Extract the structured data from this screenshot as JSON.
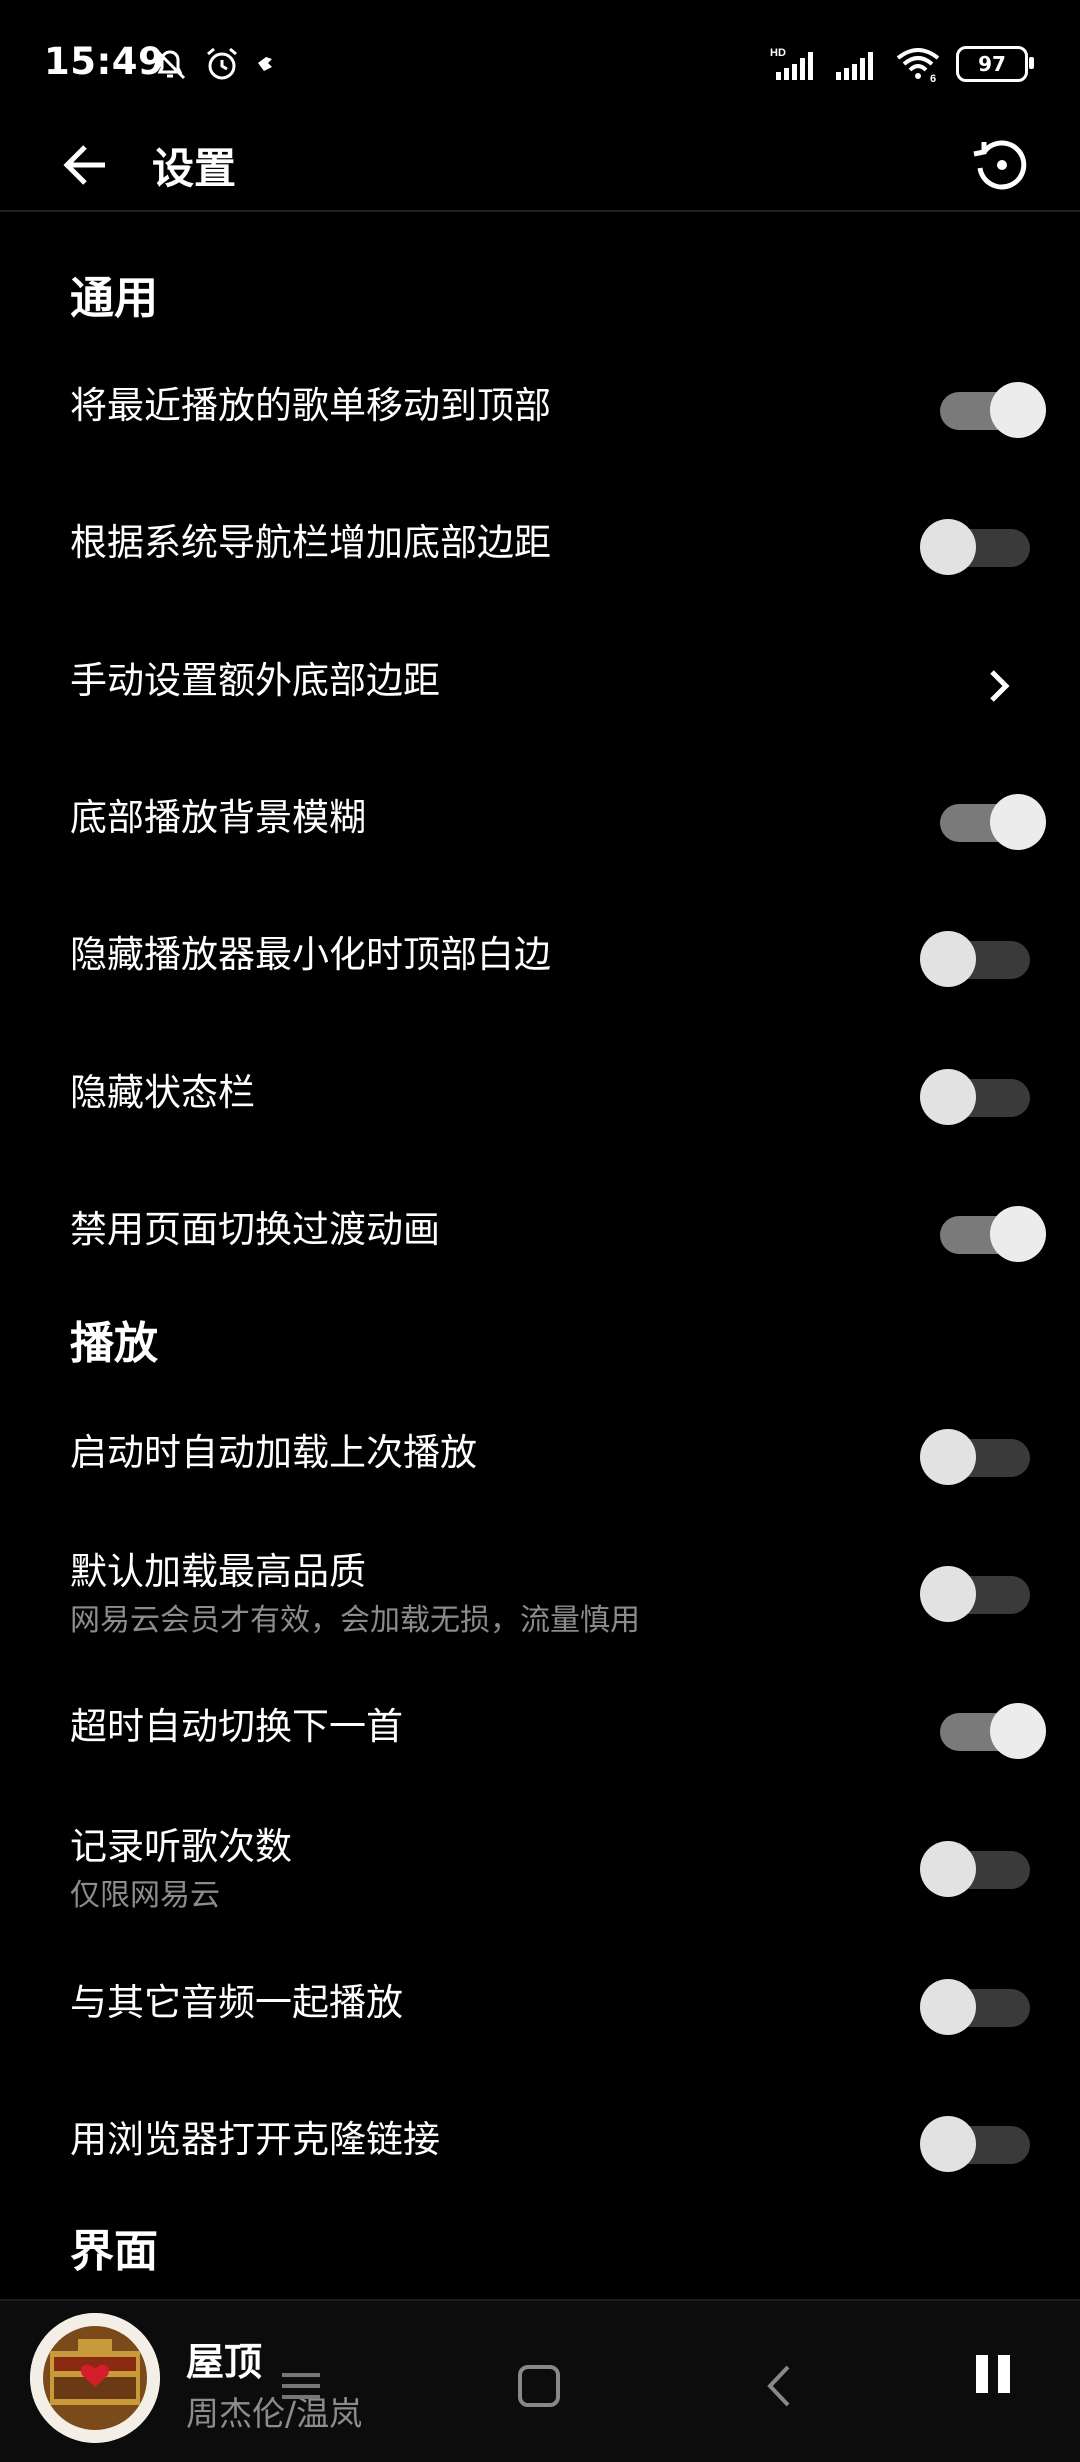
{
  "status_bar": {
    "time": "15:49",
    "battery": "97",
    "network_tag": "HD",
    "wifi_tag": "6",
    "icons": [
      "mute-bell-icon",
      "alarm-icon",
      "bird-icon",
      "signal-icon",
      "signal-icon",
      "wifi-icon",
      "battery-icon"
    ]
  },
  "appbar": {
    "title": "设置",
    "back_icon": "back-arrow-icon",
    "history_icon": "restore-icon"
  },
  "sections": [
    {
      "title": "通用",
      "items": [
        {
          "label": "将最近播放的歌单移动到顶部",
          "control": "switch",
          "on": true
        },
        {
          "label": "根据系统导航栏增加底部边距",
          "control": "switch",
          "on": false
        },
        {
          "label": "手动设置额外底部边距",
          "control": "chevron"
        },
        {
          "label": "底部播放背景模糊",
          "control": "switch",
          "on": true
        },
        {
          "label": "隐藏播放器最小化时顶部白边",
          "control": "switch",
          "on": false
        },
        {
          "label": "隐藏状态栏",
          "control": "switch",
          "on": false
        },
        {
          "label": "禁用页面切换过渡动画",
          "control": "switch",
          "on": true
        }
      ]
    },
    {
      "title": "播放",
      "items": [
        {
          "label": "启动时自动加载上次播放",
          "control": "switch",
          "on": false
        },
        {
          "label": "默认加载最高品质",
          "sub": "网易云会员才有效，会加载无损，流量慎用",
          "control": "switch",
          "on": false
        },
        {
          "label": "超时自动切换下一首",
          "control": "switch",
          "on": true
        },
        {
          "label": "记录听歌次数",
          "sub": "仅限网易云",
          "control": "switch",
          "on": false
        },
        {
          "label": "与其它音频一起播放",
          "control": "switch",
          "on": false
        },
        {
          "label": "用浏览器打开克隆链接",
          "control": "switch",
          "on": false
        }
      ]
    },
    {
      "title": "界面",
      "items": []
    }
  ],
  "player": {
    "title": "屋顶",
    "artist": "周杰伦/温岚",
    "pause_icon": "pause-icon",
    "album_icon": "album-art"
  },
  "nav_bar": {
    "icons": [
      "menu-icon",
      "home-icon",
      "back-icon"
    ]
  }
}
